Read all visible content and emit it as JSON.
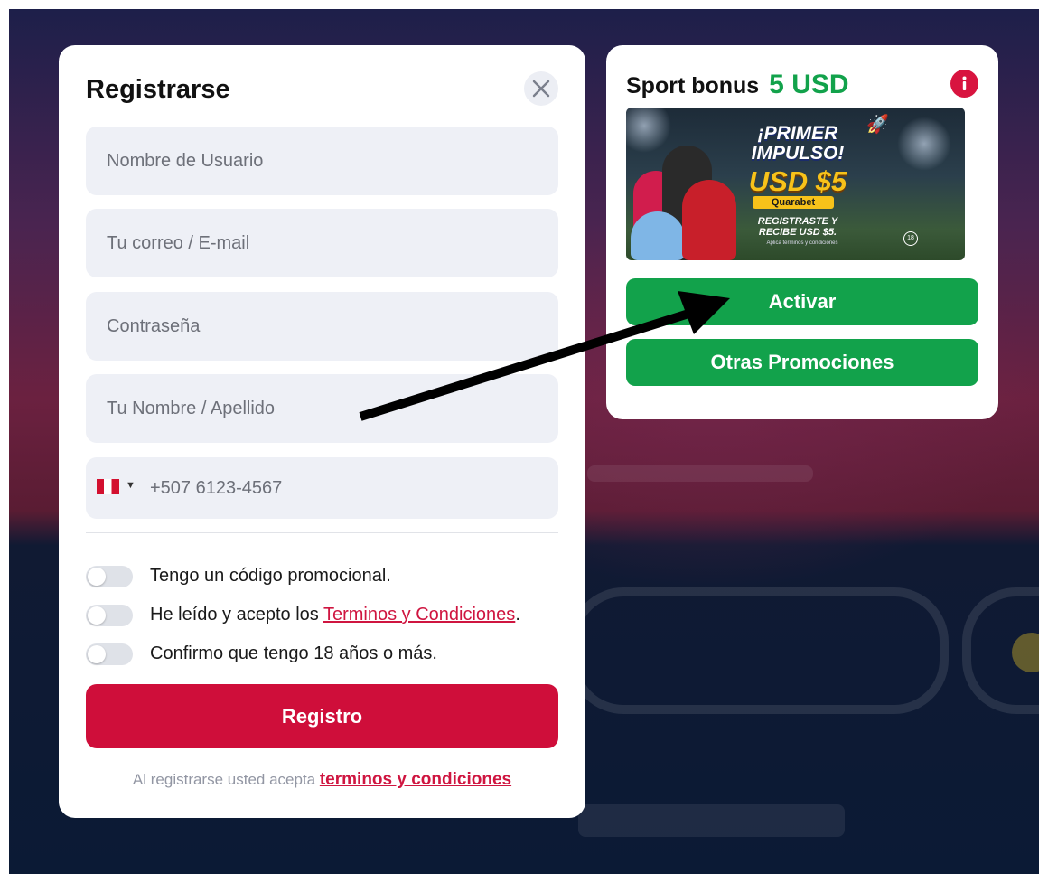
{
  "register": {
    "title": "Registrarse",
    "fields": {
      "username_placeholder": "Nombre de Usuario",
      "email_placeholder": "Tu correo / E-mail",
      "password_placeholder": "Contraseña",
      "fullname_placeholder": "Tu Nombre / Apellido",
      "phone_placeholder": "+507 6123-4567"
    },
    "toggles": {
      "promo_label": "Tengo un código promocional.",
      "terms_prefix": "He leído y acepto los ",
      "terms_link": "Terminos y Condiciones",
      "terms_suffix": ".",
      "age_label": "Confirmo que tengo 18 años o más."
    },
    "submit_label": "Registro",
    "footer": {
      "prefix": "Al registrarse usted acepta ",
      "link": "terminos y condiciones"
    }
  },
  "bonus": {
    "title_prefix": "Sport bonus",
    "amount": "5 USD",
    "banner": {
      "headline": "¡PRIMER IMPULSO!",
      "amount": "USD $5",
      "brand": "Quarabet",
      "subline": "REGISTRASTE Y RECIBE USD $5.",
      "fine_print": "Aplica terminos y condiciones",
      "age_badge": "18"
    },
    "activate_label": "Activar",
    "other_promos_label": "Otras Promociones"
  },
  "colors": {
    "brand_red": "#cf0e3a",
    "brand_green": "#12a24b",
    "field_bg": "#eef0f6"
  },
  "icons": {
    "close": "close-icon",
    "info": "info-icon",
    "flag": "peru-flag-icon",
    "caret": "caret-down-icon",
    "arrow": "arrow-annotation"
  },
  "toggle_states": {
    "promo": false,
    "terms": false,
    "age": false
  }
}
